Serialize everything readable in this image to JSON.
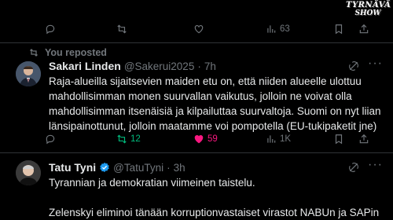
{
  "watermark": {
    "line1": "TYRNÄVÄ",
    "line2": "SHOW"
  },
  "top_actions": {
    "views": "63"
  },
  "repost_banner": "You reposted",
  "post1": {
    "name": "Sakari Linden",
    "handle": "@Sakerui2025",
    "sep": "·",
    "time": "7h",
    "lines": [
      "Raja-alueilla sijaitsevien maiden etu on, että niiden alueelle ulottuu",
      "mahdollisimman monen suurvallan vaikutus, jolloin ne voivat olla",
      "mahdollisimman itsenäisiä ja kilpailuttaa suurvaltoja. Suomi on nyt liian",
      "länsipainottunut, jolloin maatamme voi pompotella (EU-tukipaketit jne)"
    ],
    "actions": {
      "reposts": "12",
      "likes": "59",
      "views": "1K"
    },
    "colors": {
      "repost": "#00ba7c",
      "like": "#f91880"
    }
  },
  "post2": {
    "name": "Tatu Tyni",
    "handle": "@TatuTyni",
    "sep": "·",
    "time": "3h",
    "lines": [
      "Tyrannian ja demokratian viimeinen taistelu.",
      "Zelenskyi eliminoi tänään korruptionvastaiset virastot NABUn ja SAPin"
    ],
    "verified_color": "#1d9bf0"
  }
}
